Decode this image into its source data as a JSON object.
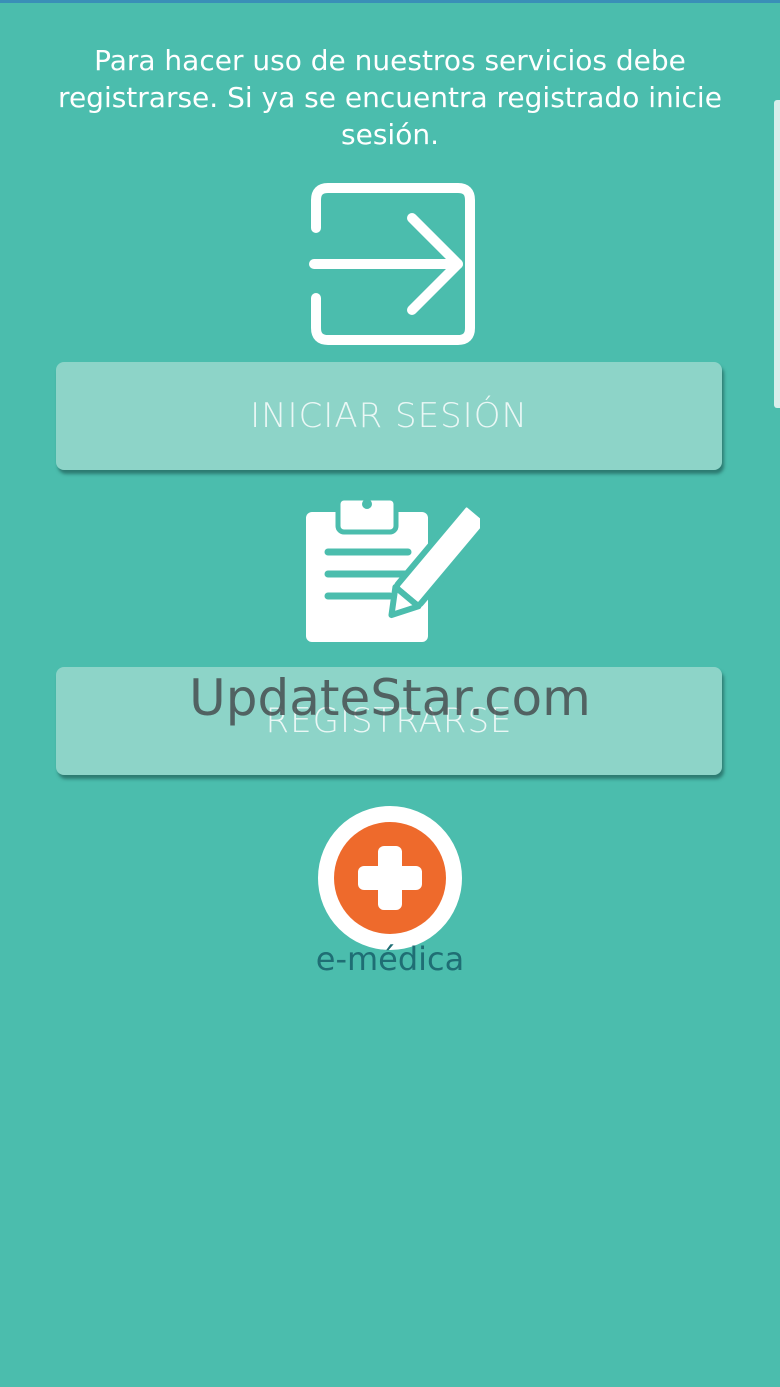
{
  "intro": {
    "text": "Para hacer uso de nuestros servicios debe registrarse. Si ya se encuentra registrado inicie sesión."
  },
  "buttons": {
    "login_label": "INICIAR SESIÓN",
    "register_label": "REGISTRARSE"
  },
  "watermark": {
    "text": "UpdateStar.com"
  },
  "logo": {
    "text": "e-médica"
  },
  "colors": {
    "background": "#4bbdad",
    "button": "#8dd4c8",
    "logo_orange": "#ee6a2c",
    "logo_text": "#1f6e74"
  },
  "icons": {
    "login": "login-arrow-icon",
    "register": "clipboard-pencil-icon",
    "logo": "medical-cross-icon"
  }
}
